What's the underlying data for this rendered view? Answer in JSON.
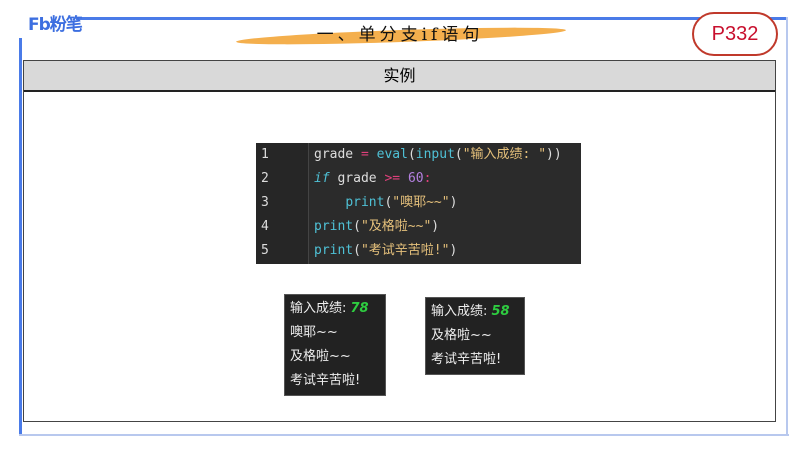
{
  "logo": "Fb粉笔",
  "title": "一、单分支if语句",
  "badge": "P332",
  "section": "实例",
  "code": [
    {
      "n": "1",
      "parts": [
        [
          "",
          "grade "
        ],
        [
          "op",
          "= "
        ],
        [
          "fn",
          "eval"
        ],
        [
          "",
          "("
        ],
        [
          "fn",
          "input"
        ],
        [
          "",
          "("
        ],
        [
          "str",
          "\"输入成绩: \""
        ],
        [
          "",
          "))"
        ]
      ]
    },
    {
      "n": "2",
      "parts": [
        [
          "kw",
          "if"
        ],
        [
          "",
          " grade "
        ],
        [
          "op",
          ">= "
        ],
        [
          "nm",
          "60"
        ],
        [
          "op",
          ":"
        ]
      ]
    },
    {
      "n": "3",
      "parts": [
        [
          "",
          "    "
        ],
        [
          "fn",
          "print"
        ],
        [
          "",
          "("
        ],
        [
          "str",
          "\"噢耶~~\""
        ],
        [
          "",
          ")"
        ]
      ]
    },
    {
      "n": "4",
      "parts": [
        [
          "fn",
          "print"
        ],
        [
          "",
          "("
        ],
        [
          "str",
          "\"及格啦~~\""
        ],
        [
          "",
          ")"
        ]
      ]
    },
    {
      "n": "5",
      "parts": [
        [
          "fn",
          "print"
        ],
        [
          "",
          "("
        ],
        [
          "str",
          "\"考试辛苦啦!\""
        ],
        [
          "",
          ")"
        ]
      ]
    }
  ],
  "outputs": [
    {
      "prompt": "输入成绩: ",
      "value": "78",
      "lines": [
        "噢耶~~",
        "及格啦~~",
        "考试辛苦啦!"
      ]
    },
    {
      "prompt": "输入成绩: ",
      "value": "58",
      "lines": [
        "及格啦~~",
        "考试辛苦啦!"
      ]
    }
  ]
}
